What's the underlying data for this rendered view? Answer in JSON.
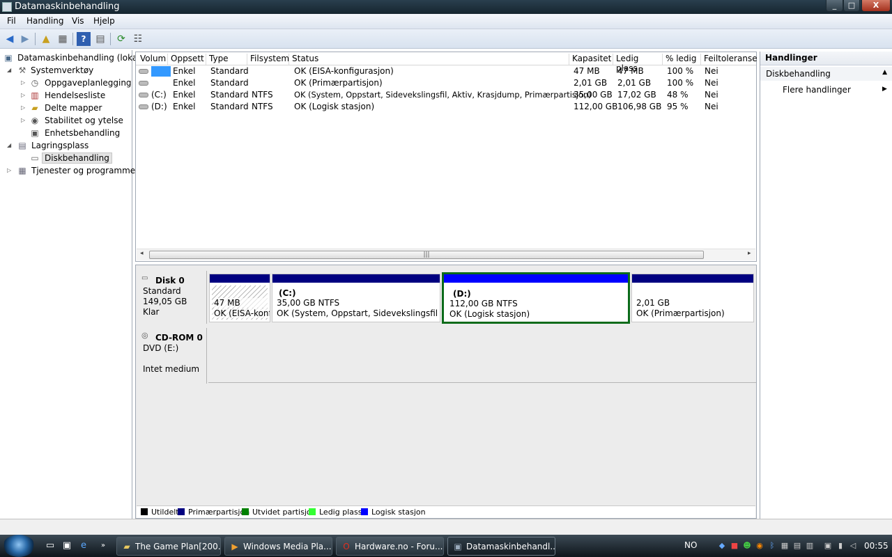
{
  "window": {
    "title": "Datamaskinbehandling"
  },
  "menu": [
    "Fil",
    "Handling",
    "Vis",
    "Hjelp"
  ],
  "tree": {
    "root": "Datamaskinbehandling (lokal)",
    "system_tools": "Systemverktøy",
    "task_scheduler": "Oppgaveplanlegging",
    "event_viewer": "Hendelsesliste",
    "shared_folders": "Delte mapper",
    "reliability": "Stabilitet og ytelse",
    "device_manager": "Enhetsbehandling",
    "storage": "Lagringsplass",
    "disk_management": "Diskbehandling",
    "services": "Tjenester og programmer"
  },
  "volumes": {
    "headers": [
      "Volum",
      "Oppsett",
      "Type",
      "Filsystem",
      "Status",
      "Kapasitet",
      "Ledig plass",
      "% ledig",
      "Feiltoleranse"
    ],
    "rows": [
      [
        "",
        "Enkel",
        "Standard",
        "",
        "OK (EISA-konfigurasjon)",
        "47 MB",
        "47 MB",
        "100 %",
        "Nei"
      ],
      [
        "",
        "Enkel",
        "Standard",
        "",
        "OK (Primærpartisjon)",
        "2,01 GB",
        "2,01 GB",
        "100 %",
        "Nei"
      ],
      [
        "(C:)",
        "Enkel",
        "Standard",
        "NTFS",
        "OK (System, Oppstart, Sidevekslingsfil, Aktiv, Krasjdump, Primærpartisjon)",
        "35,00 GB",
        "17,02 GB",
        "48 %",
        "Nei"
      ],
      [
        "(D:)",
        "Enkel",
        "Standard",
        "NTFS",
        "OK (Logisk stasjon)",
        "112,00 GB",
        "106,98 GB",
        "95 %",
        "Nei"
      ]
    ]
  },
  "disk0": {
    "name": "Disk 0",
    "type": "Standard",
    "size": "149,05 GB",
    "state": "Klar",
    "partitions": {
      "eisa": {
        "size": "47 MB",
        "status": "OK (EISA-konf"
      },
      "c": {
        "label": "(C:)",
        "size": "35,00 GB NTFS",
        "status": "OK (System, Oppstart, Sidevekslingsfil, Aktiv"
      },
      "d": {
        "label": "(D:)",
        "size": "112,00 GB NTFS",
        "status": "OK (Logisk stasjon)"
      },
      "p": {
        "size": "2,01 GB",
        "status": "OK (Primærpartisjon)"
      }
    }
  },
  "cdrom0": {
    "name": "CD-ROM 0",
    "type": "DVD (E:)",
    "state": "Intet medium"
  },
  "legend": [
    "Utildelt",
    "Primærpartisjon",
    "Utvidet partisjon",
    "Ledig plass",
    "Logisk stasjon"
  ],
  "legend_colors": [
    "#000000",
    "#000080",
    "#008000",
    "#33ff33",
    "#0000ff"
  ],
  "actions": {
    "header": "Handlinger",
    "section": "Diskbehandling",
    "more": "Flere handlinger"
  },
  "taskbar": {
    "tasks": [
      "The Game Plan[200...",
      "Windows Media Pla...",
      "Hardware.no - Foru...",
      "Datamaskinbehandl..."
    ],
    "language": "NO",
    "clock": "00:55"
  }
}
